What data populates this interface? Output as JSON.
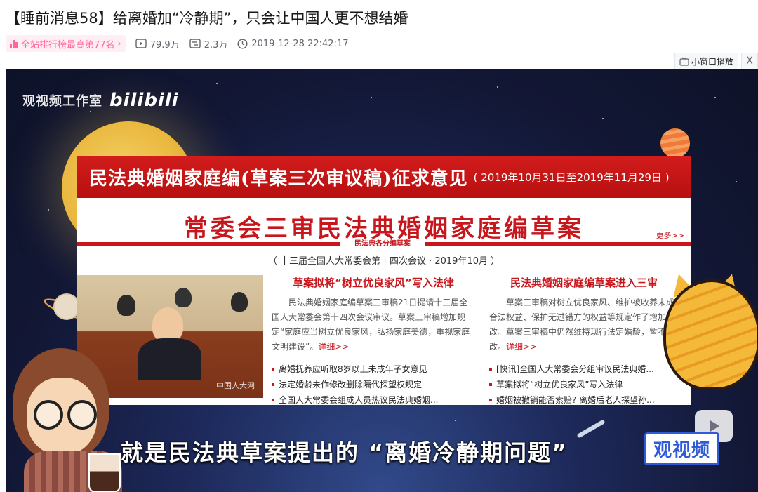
{
  "page": {
    "title": "【睡前消息58】给离婚加“冷静期”，只会让中国人更不想结婚"
  },
  "meta": {
    "rank_label": "全站排行榜最高第77名",
    "rank_chevron": "›",
    "views": "79.9万",
    "danmaku": "2.3万",
    "publish_time": "2019-12-28 22:42:17",
    "views_icon": "play-count-icon",
    "danmaku_icon": "danmaku-icon",
    "time_icon": "clock-icon"
  },
  "player_controls": {
    "mini_window_label": "小窗口播放",
    "close_label": "X"
  },
  "video": {
    "watermark_studio": "观视频工作室",
    "watermark_brand": "bilibili",
    "subtitle": "就是民法典草案提出的 “离婚冷静期问题”",
    "logo_text": "观视频",
    "card": {
      "banner_main": "民法典婚姻家庭编(草案三次审议稿)征求意见",
      "banner_dates": "( 2019年10月31日至2019年11月29日 )",
      "headline": "常委会三审民法典婚姻家庭编草案",
      "more_link": "更多>>",
      "sub_tag": "民法典各分编草案",
      "session": "（ 十三届全国人大常委会第十四次会议 · 2019年10月 ）",
      "photo_caption": "中国人大网",
      "article1": {
        "title": "草案拟将“树立优良家风”写入法律",
        "body": "民法典婚姻家庭编草案三审稿21日提请十三届全国人大常委会第十四次会议审议。草案三审稿增加规定“家庭应当树立优良家风，弘扬家庭美德，重视家庭文明建设”。",
        "detail_link": "详细>>",
        "links": [
          "离婚抚养应听取8岁以上未成年子女意见",
          "法定婚龄未作修改删除隔代探望权规定",
          "全国人大常委会组成人员热议民法典婚姻..."
        ]
      },
      "article2": {
        "title": "民法典婚姻家庭编草案进入三审",
        "body": "草案三审稿对树立优良家风、维护被收养未成年人合法权益、保护无过错方的权益等规定作了增加或修改。草案三审稿中仍然维持现行法定婚龄，暂不作修改。",
        "detail_link": "详细>>",
        "links": [
          "[快讯]全国人大常委会分组审议民法典婚...",
          "草案拟将“树立优良家风”写入法律",
          "婚姻被撤销能否索赔? 离婚后老人探望孙..."
        ]
      }
    }
  },
  "colors": {
    "bili_pink": "#ff6699",
    "headline_red": "#c8161d",
    "banner_red": "#c81818",
    "video_bg": "#1a2250"
  }
}
